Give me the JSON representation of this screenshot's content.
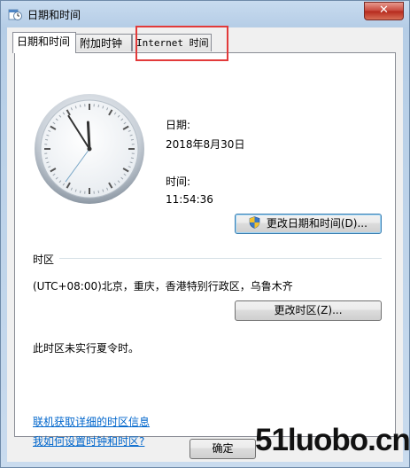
{
  "window": {
    "title": "日期和时间",
    "close_symbol": "✕"
  },
  "tabs": [
    {
      "label": "日期和时间",
      "active": true
    },
    {
      "label": "附加时钟",
      "active": false
    },
    {
      "label": "Internet 时间",
      "active": false
    }
  ],
  "clock": {
    "hour": 11,
    "minute": 54,
    "second": 36
  },
  "date": {
    "label": "日期:",
    "value": "2018年8月30日"
  },
  "time": {
    "label": "时间:",
    "value": "11:54:36"
  },
  "change_datetime_button": "更改日期和时间(D)...",
  "timezone": {
    "heading": "时区",
    "value": "(UTC+08:00)北京，重庆，香港特别行政区，乌鲁木齐",
    "change_button": "更改时区(Z)...",
    "dst_note": "此时区未实行夏令时。"
  },
  "links": {
    "timezone_info": "联机获取详细的时区信息",
    "how_to_set": "我如何设置时钟和时区?"
  },
  "footer": {
    "ok_button": "确定"
  },
  "watermark": "51luobo.cn",
  "colors": {
    "highlight": "#e23a3a",
    "link": "#0066cc"
  }
}
